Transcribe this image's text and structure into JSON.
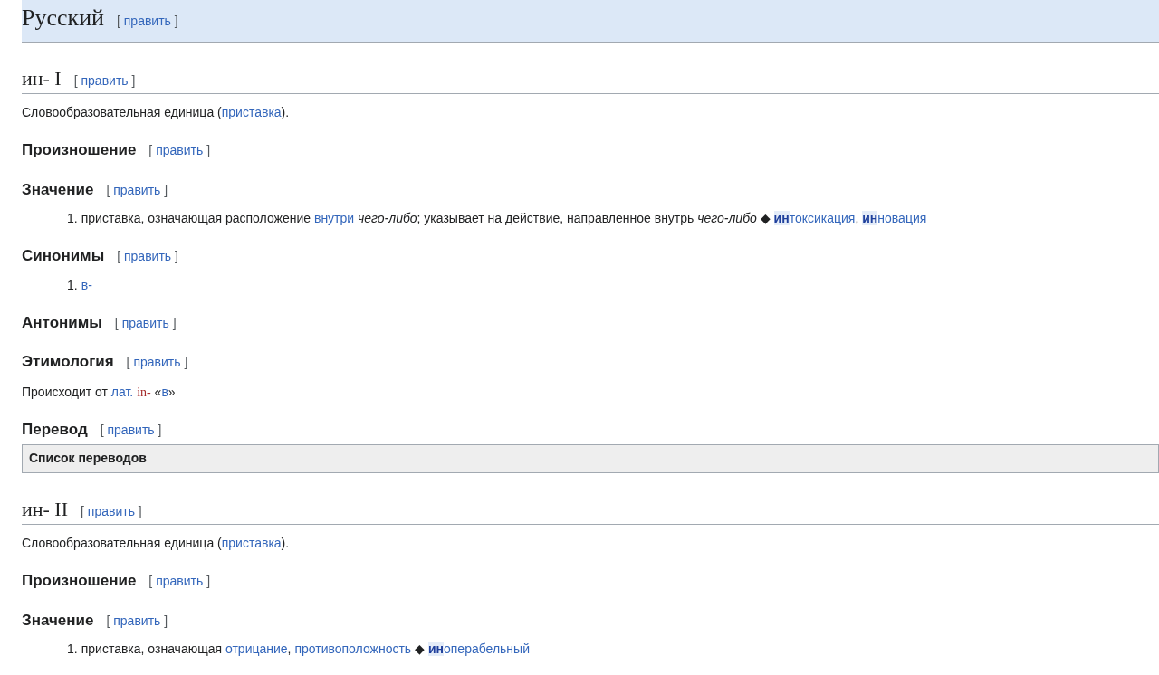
{
  "blocks": [
    {
      "kind": "language_header",
      "title": "Русский",
      "edit": [
        {
          "kind": "bracket",
          "text": "["
        },
        {
          "kind": "link",
          "text": "править"
        },
        {
          "kind": "bracket",
          "text": "]"
        }
      ]
    },
    {
      "kind": "h2",
      "title": "ин- I",
      "edit": [
        {
          "kind": "bracket",
          "text": "["
        },
        {
          "kind": "link",
          "text": "править"
        },
        {
          "kind": "bracket",
          "text": "]"
        }
      ]
    },
    {
      "kind": "paragraph",
      "segments": [
        {
          "kind": "plain",
          "text": "Словообразовательная единица ("
        },
        {
          "kind": "link",
          "text": "приставка"
        },
        {
          "kind": "plain",
          "text": ")."
        }
      ]
    },
    {
      "kind": "h3",
      "title": "Произношение",
      "edit": [
        {
          "kind": "bracket",
          "text": "["
        },
        {
          "kind": "link",
          "text": "править"
        },
        {
          "kind": "bracket",
          "text": "]"
        }
      ]
    },
    {
      "kind": "h3",
      "title": "Значение",
      "edit": [
        {
          "kind": "bracket",
          "text": "["
        },
        {
          "kind": "link",
          "text": "править"
        },
        {
          "kind": "bracket",
          "text": "]"
        }
      ]
    },
    {
      "kind": "list",
      "items": [
        {
          "number": "1.",
          "segments": [
            {
              "kind": "plain",
              "text": "приставка, означающая расположение "
            },
            {
              "kind": "link",
              "text": "внутри"
            },
            {
              "kind": "space"
            },
            {
              "kind": "italic",
              "text": "чего-либо"
            },
            {
              "kind": "plain",
              "text": "; указывает на действие, направленное внутрь "
            },
            {
              "kind": "italic",
              "text": "чего-либо"
            },
            {
              "kind": "plain",
              "text": " ◆ "
            },
            {
              "kind": "link",
              "text": "**ин**токсикация"
            },
            {
              "kind": "plain",
              "text": ", "
            },
            {
              "kind": "link",
              "text": "**ин**новация"
            }
          ]
        }
      ]
    },
    {
      "kind": "h3",
      "title": "Синонимы",
      "edit": [
        {
          "kind": "bracket",
          "text": "["
        },
        {
          "kind": "link",
          "text": "править"
        },
        {
          "kind": "bracket",
          "text": "]"
        }
      ]
    },
    {
      "kind": "list",
      "items": [
        {
          "number": "1.",
          "segments": [
            {
              "kind": "link",
              "text": "в-"
            }
          ]
        }
      ]
    },
    {
      "kind": "h3",
      "title": "Антонимы",
      "edit": [
        {
          "kind": "bracket",
          "text": "["
        },
        {
          "kind": "link",
          "text": "править"
        },
        {
          "kind": "bracket",
          "text": "]"
        }
      ]
    },
    {
      "kind": "h3",
      "title": "Этимология",
      "edit": [
        {
          "kind": "bracket",
          "text": "["
        },
        {
          "kind": "link",
          "text": "править"
        },
        {
          "kind": "bracket",
          "text": "]"
        }
      ]
    },
    {
      "kind": "paragraph",
      "segments": [
        {
          "kind": "plain",
          "text": "Происходит от "
        },
        {
          "kind": "link",
          "text": "лат."
        },
        {
          "kind": "space"
        },
        {
          "kind": "foreign",
          "text": "in-"
        },
        {
          "kind": "plain",
          "text": " «"
        },
        {
          "kind": "link",
          "text": "в"
        },
        {
          "kind": "plain",
          "text": "»"
        }
      ]
    },
    {
      "kind": "h3",
      "title": "Перевод",
      "edit": [
        {
          "kind": "bracket",
          "text": "["
        },
        {
          "kind": "link",
          "text": "править"
        },
        {
          "kind": "bracket",
          "text": "]"
        }
      ]
    },
    {
      "kind": "translation_box",
      "title": "Список переводов"
    },
    {
      "kind": "h2",
      "title": "ин- II",
      "edit": [
        {
          "kind": "bracket",
          "text": "["
        },
        {
          "kind": "link",
          "text": "править"
        },
        {
          "kind": "bracket",
          "text": "]"
        }
      ]
    },
    {
      "kind": "paragraph",
      "segments": [
        {
          "kind": "plain",
          "text": "Словообразовательная единица ("
        },
        {
          "kind": "link",
          "text": "приставка"
        },
        {
          "kind": "plain",
          "text": ")."
        }
      ]
    },
    {
      "kind": "h3",
      "title": "Произношение",
      "edit": [
        {
          "kind": "bracket",
          "text": "["
        },
        {
          "kind": "link",
          "text": "править"
        },
        {
          "kind": "bracket",
          "text": "]"
        }
      ]
    },
    {
      "kind": "h3",
      "title": "Значение",
      "edit": [
        {
          "kind": "bracket",
          "text": "["
        },
        {
          "kind": "link",
          "text": "править"
        },
        {
          "kind": "bracket",
          "text": "]"
        }
      ]
    },
    {
      "kind": "list",
      "items": [
        {
          "number": "1.",
          "segments": [
            {
              "kind": "plain",
              "text": "приставка, означающая "
            },
            {
              "kind": "link",
              "text": "отрицание"
            },
            {
              "kind": "plain",
              "text": ", "
            },
            {
              "kind": "link",
              "text": "противоположность"
            },
            {
              "kind": "plain",
              "text": " ◆ "
            },
            {
              "kind": "link",
              "text": "**ин**операбельный"
            }
          ]
        }
      ]
    }
  ]
}
